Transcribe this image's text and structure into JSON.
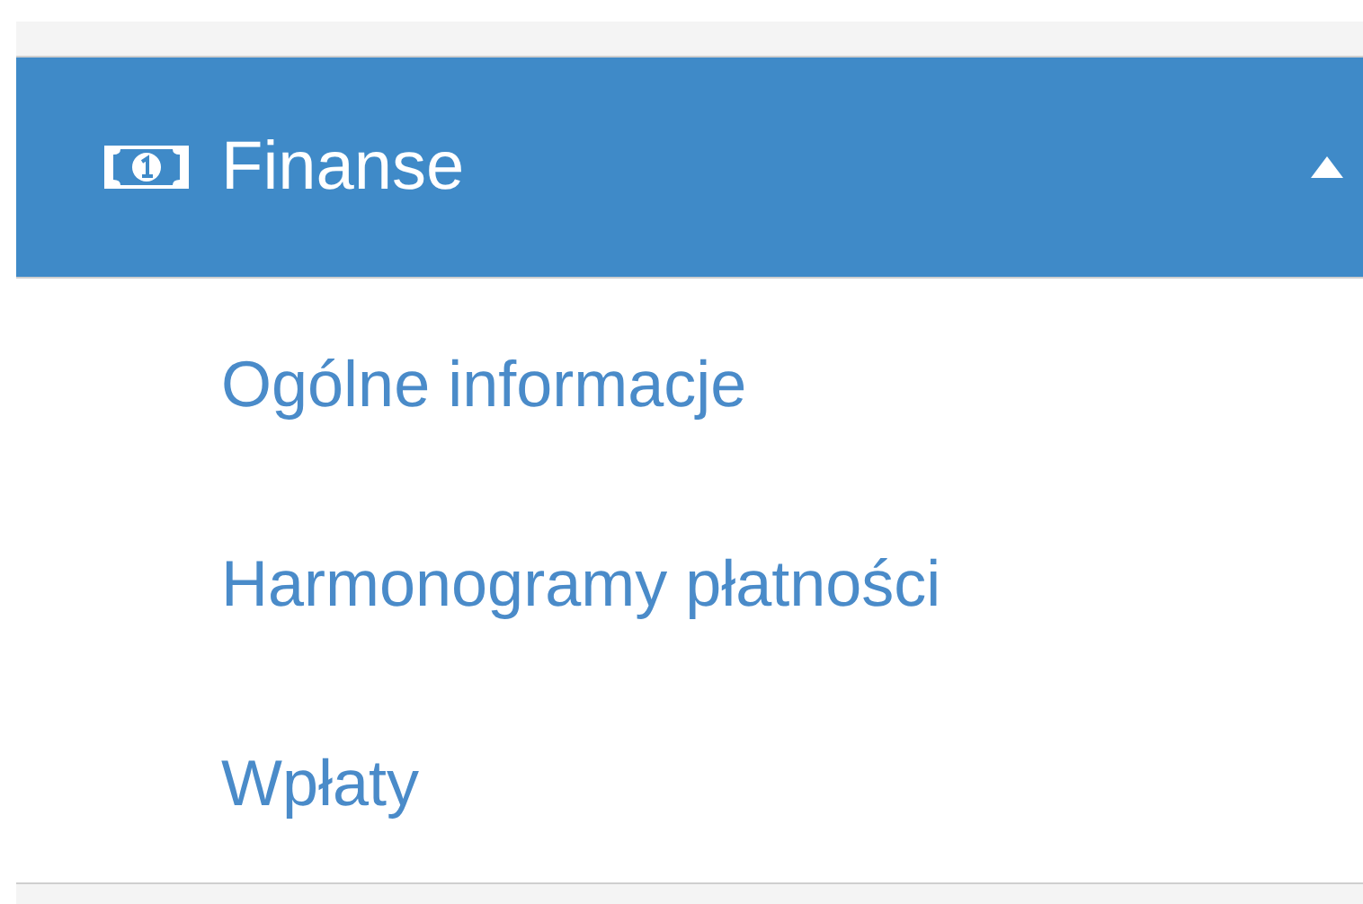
{
  "menu": {
    "label": "Finanse",
    "expanded": true,
    "items": [
      {
        "label": "Ogólne informacje"
      },
      {
        "label": "Harmonogramy płatności"
      },
      {
        "label": "Wpłaty"
      }
    ]
  }
}
